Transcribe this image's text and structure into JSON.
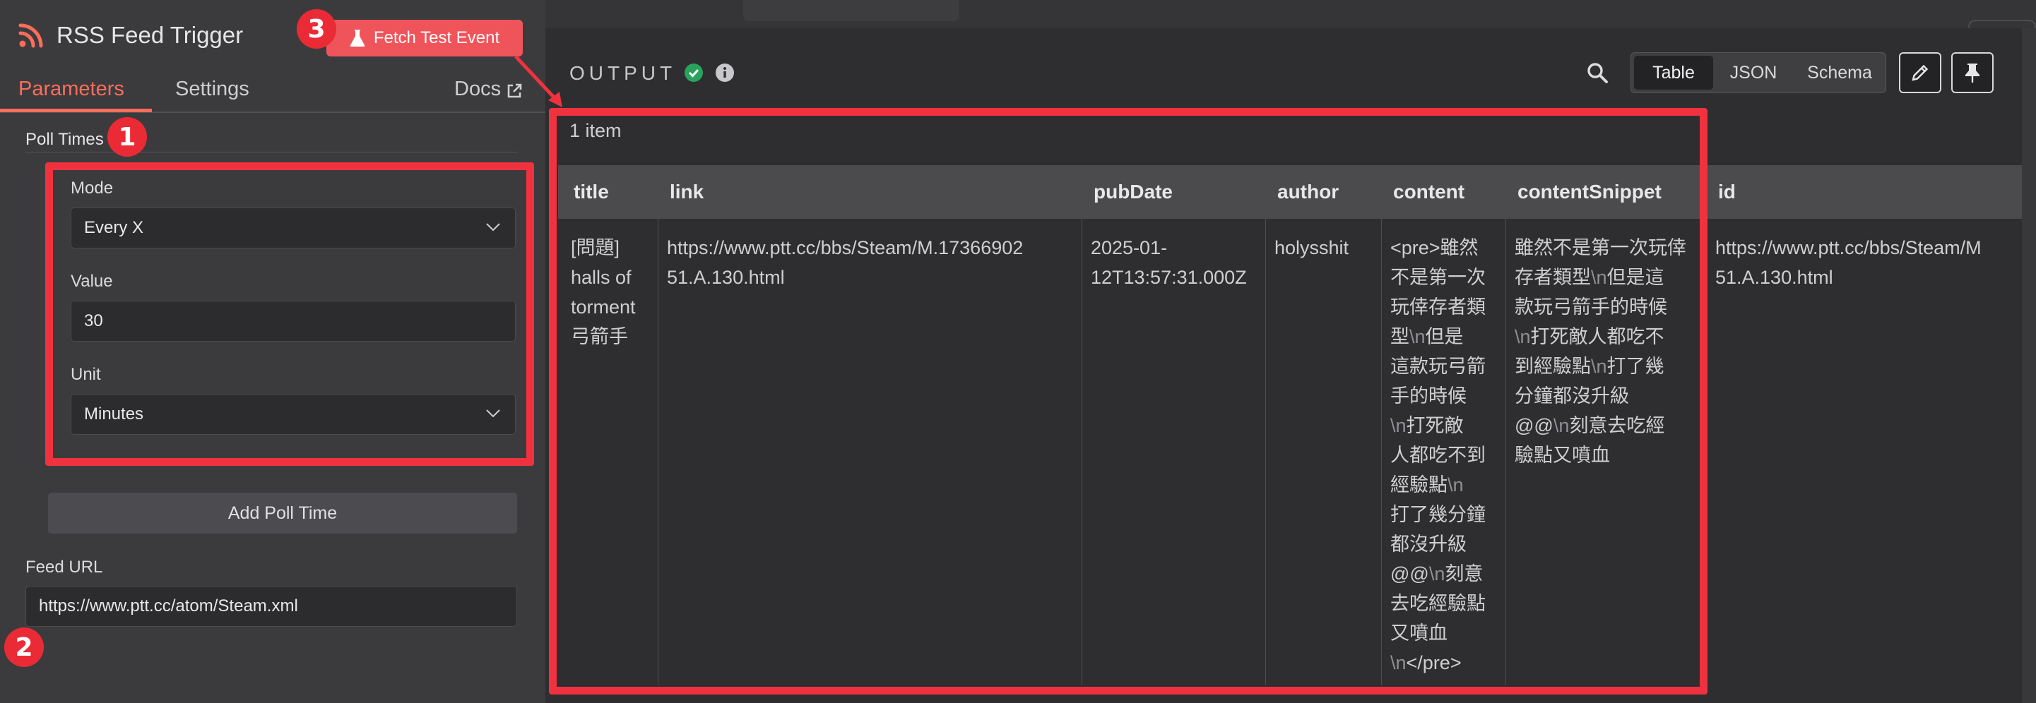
{
  "node": {
    "title": "RSS Feed Trigger",
    "fetch_button": "Fetch Test Event",
    "accent_color": "#ff6d5a",
    "button_color": "#f0545b"
  },
  "tabs": {
    "parameters": "Parameters",
    "settings": "Settings",
    "docs": "Docs"
  },
  "form": {
    "poll_times_label": "Poll Times",
    "mode_label": "Mode",
    "mode_value": "Every X",
    "value_label": "Value",
    "value_value": "30",
    "unit_label": "Unit",
    "unit_value": "Minutes",
    "add_poll_button": "Add Poll Time",
    "feed_url_label": "Feed URL",
    "feed_url_value": "https://www.ptt.cc/atom/Steam.xml"
  },
  "annotations": {
    "badge_1": "1",
    "badge_2": "2",
    "badge_3": "3",
    "color": "#f0323f"
  },
  "output": {
    "title": "OUTPUT",
    "views": {
      "table": "Table",
      "json": "JSON",
      "schema": "Schema"
    },
    "active_view": "Table",
    "item_count": "1 item",
    "columns": {
      "title": "title",
      "link": "link",
      "pubDate": "pubDate",
      "author": "author",
      "content": "content",
      "contentSnippet": "contentSnippet",
      "id": "id"
    },
    "row": {
      "title": [
        "[問題]",
        "halls of",
        "torment",
        "弓箭手"
      ],
      "link": [
        "https://www.ptt.cc/bbs/Steam/M.17366902",
        "51.A.130.html"
      ],
      "pubDate": [
        "2025-01-",
        "12T13:57:31.000Z"
      ],
      "author": "holysshit",
      "content": [
        "<pre>雖然",
        "不是第一次",
        "玩倖存者類",
        "型",
        "但是",
        "這款玩弓箭",
        "手的時候",
        "打死敵",
        "人都吃不到",
        "經驗點",
        "打了幾分鐘",
        "都沒升級",
        "@@",
        "刻意",
        "去吃經驗點",
        "又噴血",
        "</pre>"
      ],
      "contentSnippet": [
        "雖然不是第一次玩倖",
        "存者類型",
        "但是這",
        "款玩弓箭手的時候",
        "打死敵人都吃不",
        "到經驗點",
        "打了幾",
        "分鐘都沒升級",
        "@@",
        "刻意去吃經",
        "驗點又噴血"
      ],
      "id": [
        "https://www.ptt.cc/bbs/Steam/M",
        "51.A.130.html"
      ],
      "escape_token": "\\n"
    }
  }
}
